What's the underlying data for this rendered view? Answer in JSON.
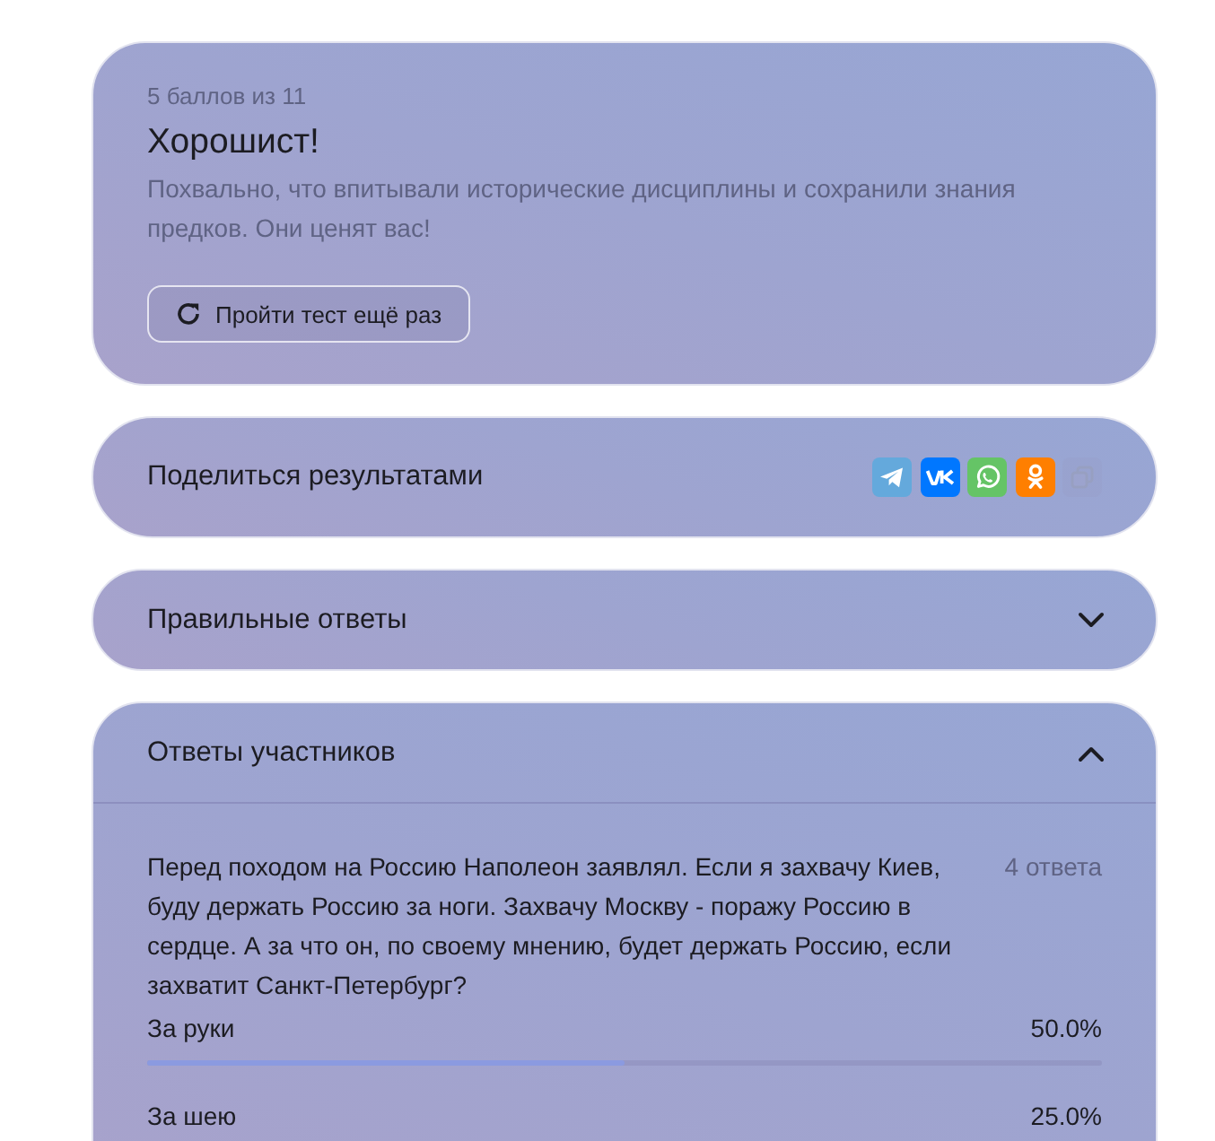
{
  "result": {
    "score": "5 баллов из 11",
    "title": "Хорошист!",
    "description": "Похвально, что впитывали исторические дисциплины и сохранили знания предков. Они ценят вас!",
    "retry_button": "Пройти тест ещё раз"
  },
  "share": {
    "label": "Поделиться результатами",
    "services": [
      {
        "kind": "telegram",
        "disabled": false
      },
      {
        "kind": "vk",
        "disabled": false
      },
      {
        "kind": "whatsapp",
        "disabled": false
      },
      {
        "kind": "odnoklassniki",
        "disabled": false
      },
      {
        "kind": "copy",
        "disabled": true
      }
    ]
  },
  "sections": [
    {
      "title": "Правильные ответы",
      "expanded": false
    },
    {
      "title": "Ответы участников",
      "expanded": true,
      "questions": [
        {
          "text": "Перед походом на Россию Наполеон заявлял. Если я захвачу Киев, буду держать Россию за ноги. Захвачу Москву - поражу Россию в сердце. А за что он, по своему мнению, будет держать Россию, если захватит Санкт-Петербург?",
          "count": "4 ответа",
          "answers": [
            {
              "label": "За руки",
              "percent": "50.0%",
              "level": 0.5
            },
            {
              "label": "За шею",
              "percent": "25.0%"
            }
          ]
        }
      ]
    }
  ]
}
